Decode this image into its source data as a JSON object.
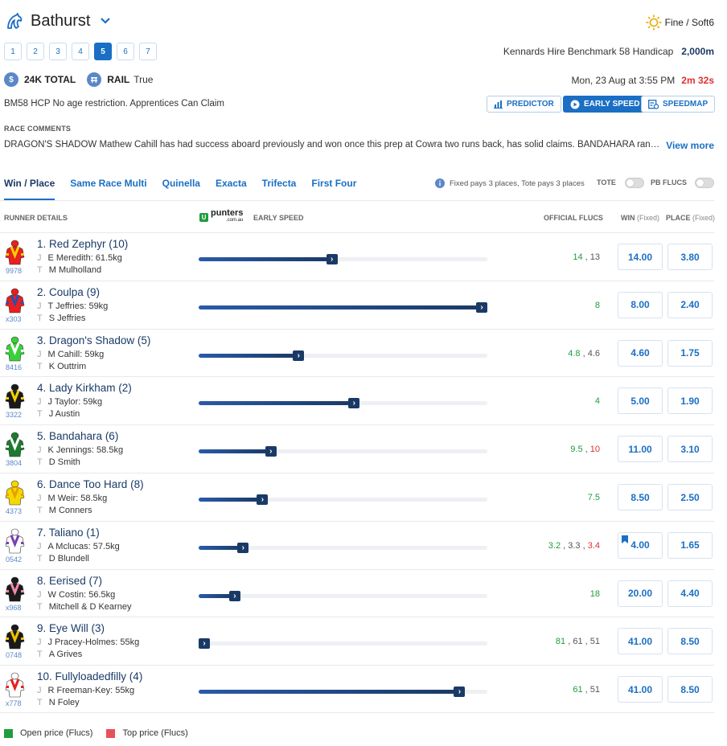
{
  "header": {
    "venue": "Bathurst",
    "weather": "Fine / Soft6",
    "race_numbers": [
      "1",
      "2",
      "3",
      "4",
      "5",
      "6",
      "7"
    ],
    "active_race": "5",
    "race_name": "Kennards Hire Benchmark 58 Handicap",
    "distance": "2,000m",
    "prize_icon": "$",
    "prize": "24K TOTAL",
    "rail_label": "RAIL",
    "rail_value": "True",
    "date": "Mon, 23 Aug at 3:55 PM",
    "countdown": "2m 32s",
    "conditions": "BM58 HCP  No age restriction.  Apprentices Can Claim",
    "buttons": {
      "predictor": "PREDICTOR",
      "early_speed": "EARLY SPEED",
      "speedmap": "SPEEDMAP"
    }
  },
  "comments": {
    "label": "RACE COMMENTS",
    "text": "DRAGON'S SHADOW Mathew Cahill has had success aboard previously and won once this prep at Cowra two runs back, has solid claims. BANDAHARA ran a l...",
    "view_more": "View more"
  },
  "bet_tabs": [
    "Win / Place",
    "Same Race Multi",
    "Quinella",
    "Exacta",
    "Trifecta",
    "First Four"
  ],
  "pays_note": "Fixed pays 3 places, Tote pays 3 places",
  "tote_label": "TOTE",
  "pbflucs_label": "PB FLUCS",
  "table_headers": {
    "runner": "RUNNER DETAILS",
    "logo_main": "punters",
    "logo_sub": ".com.au",
    "early_speed": "EARLY SPEED",
    "flucs": "OFFICIAL FLUCS",
    "win": "WIN",
    "win_sub": "(Fixed)",
    "place": "PLACE",
    "place_sub": "(Fixed)"
  },
  "runners": [
    {
      "name": "1. Red Zephyr  (10)",
      "jockey": "E Meredith: 61.5kg",
      "trainer": "M Mulholland",
      "silk_id": "9978",
      "speed": 0.46,
      "flucs": [
        [
          "14",
          "g"
        ],
        [
          "13",
          ""
        ]
      ],
      "win": "14.00",
      "place": "3.80",
      "colors": [
        "#e8201f",
        "#f5d000"
      ]
    },
    {
      "name": "2. Coulpa  (9)",
      "jockey": "T Jeffries: 59kg",
      "trainer": "S Jeffries",
      "silk_id": "x303",
      "speed": 1.0,
      "flucs": [
        [
          "8",
          "g"
        ]
      ],
      "win": "8.00",
      "place": "2.40",
      "colors": [
        "#e8201f",
        "#2a4fb0"
      ]
    },
    {
      "name": "3. Dragon's Shadow  (5)",
      "jockey": "M Cahill: 59kg",
      "trainer": "K Outtrim",
      "silk_id": "8416",
      "speed": 0.34,
      "flucs": [
        [
          "4.8",
          "g"
        ],
        [
          "4.6",
          ""
        ]
      ],
      "win": "4.60",
      "place": "1.75",
      "colors": [
        "#3ccf3c",
        "#ffffff"
      ]
    },
    {
      "name": "4. Lady Kirkham  (2)",
      "jockey": "J Taylor: 59kg",
      "trainer": "J Austin",
      "silk_id": "3322",
      "speed": 0.54,
      "flucs": [
        [
          "4",
          "g"
        ]
      ],
      "win": "5.00",
      "place": "1.90",
      "colors": [
        "#1a1a1a",
        "#f5d000"
      ]
    },
    {
      "name": "5. Bandahara  (6)",
      "jockey": "K Jennings: 58.5kg",
      "trainer": "D Smith",
      "silk_id": "3804",
      "speed": 0.24,
      "flucs": [
        [
          "9.5",
          "g"
        ],
        [
          "10",
          "r"
        ]
      ],
      "win": "11.00",
      "place": "3.10",
      "colors": [
        "#1e7a30",
        "#ffffff"
      ]
    },
    {
      "name": "6. Dance Too Hard  (8)",
      "jockey": "M Weir: 58.5kg",
      "trainer": "M Conners",
      "silk_id": "4373",
      "speed": 0.21,
      "flucs": [
        [
          "7.5",
          "g"
        ]
      ],
      "win": "8.50",
      "place": "2.50",
      "colors": [
        "#f5d800",
        "#e8a000"
      ]
    },
    {
      "name": "7. Taliano  (1)",
      "jockey": "A Mclucas: 57.5kg",
      "trainer": "D Blundell",
      "silk_id": "0542",
      "speed": 0.14,
      "flucs": [
        [
          "3.2",
          "g"
        ],
        [
          "3.3",
          ""
        ],
        [
          "3.4",
          "r"
        ]
      ],
      "win": "4.00",
      "place": "1.65",
      "colors": [
        "#ffffff",
        "#7a3fb0"
      ],
      "bookmark": true
    },
    {
      "name": "8. Eerised  (7)",
      "jockey": "W Costin: 56.5kg",
      "trainer": "Mitchell & D Kearney",
      "silk_id": "x968",
      "speed": 0.11,
      "flucs": [
        [
          "18",
          "g"
        ]
      ],
      "win": "20.00",
      "place": "4.40",
      "colors": [
        "#1a1a1a",
        "#f08aa8"
      ]
    },
    {
      "name": "9. Eye Will  (3)",
      "jockey": "J Pracey-Holmes: 55kg",
      "trainer": "A Grives",
      "silk_id": "0748",
      "speed": 0.0,
      "flucs": [
        [
          "81",
          "g"
        ],
        [
          "61",
          ""
        ],
        [
          "51",
          ""
        ]
      ],
      "win": "41.00",
      "place": "8.50",
      "colors": [
        "#1a1a1a",
        "#f5c000"
      ]
    },
    {
      "name": "10. Fullyloadedfilly  (4)",
      "jockey": "R Freeman-Key: 55kg",
      "trainer": "N Foley",
      "silk_id": "x778",
      "speed": 0.92,
      "flucs": [
        [
          "61",
          "g"
        ],
        [
          "51",
          ""
        ]
      ],
      "win": "41.00",
      "place": "8.50",
      "colors": [
        "#ffffff",
        "#e8201f"
      ]
    }
  ],
  "legend": {
    "open": "Open price (Flucs)",
    "open_color": "#1e9e3e",
    "top": "Top price (Flucs)",
    "top_color": "#e8505a"
  },
  "colors": {
    "accent": "#1a6fc4",
    "navy": "#1a3a66"
  }
}
